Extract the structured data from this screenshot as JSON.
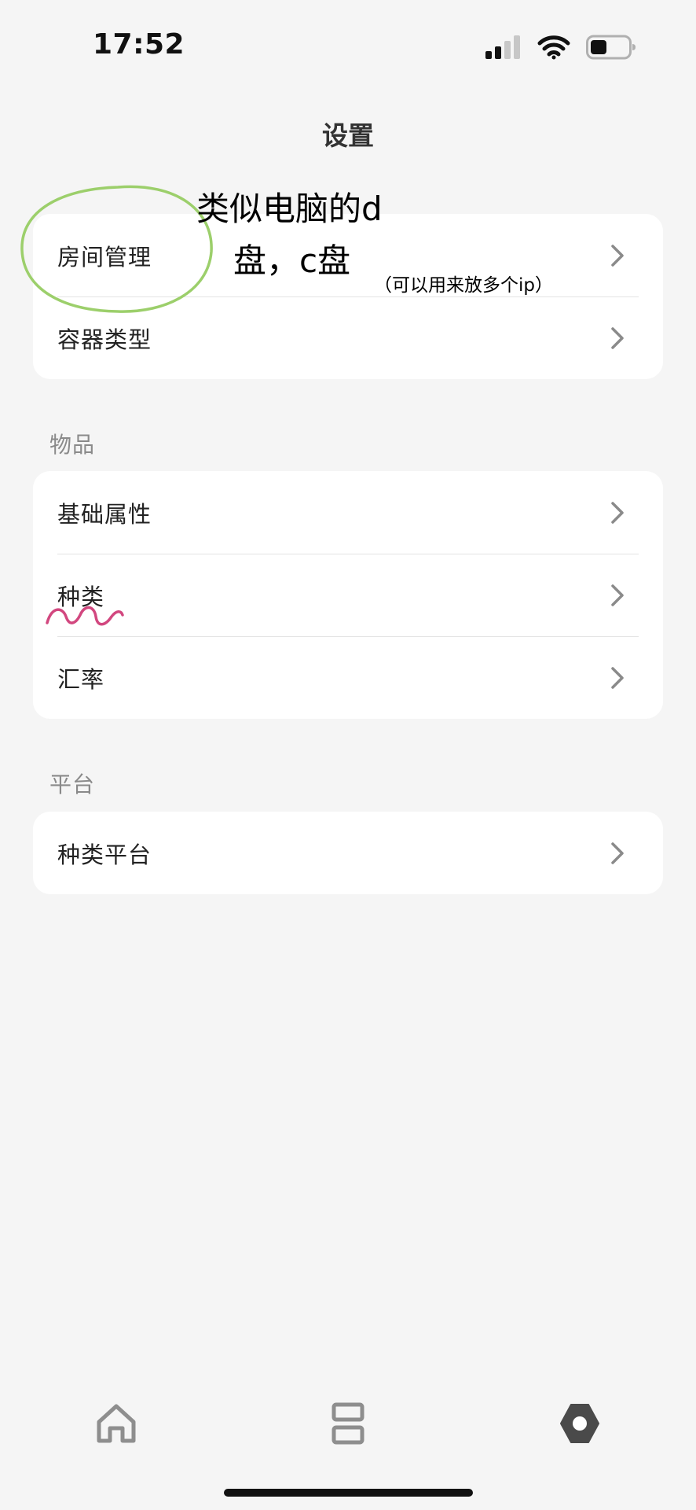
{
  "status_bar": {
    "time": "17:52",
    "icons": [
      "signal-icon",
      "wifi-icon",
      "battery-icon"
    ]
  },
  "header": {
    "title": "设置"
  },
  "groups": [
    {
      "title": "",
      "items": [
        {
          "label": "房间管理"
        },
        {
          "label": "容器类型"
        }
      ]
    },
    {
      "title": "物品",
      "items": [
        {
          "label": "基础属性"
        },
        {
          "label": "种类"
        },
        {
          "label": "汇率"
        }
      ]
    },
    {
      "title": "平台",
      "items": [
        {
          "label": "种类平台"
        }
      ]
    }
  ],
  "annotations": {
    "line1": "类似电脑的d",
    "line2": "盘，c盘",
    "note": "（可以用来放多个ip）",
    "circle_color": "#9ccf6b",
    "squiggle_color": "#d2477f"
  },
  "tab_bar": {
    "items": [
      {
        "icon": "home-icon",
        "active": false
      },
      {
        "icon": "list-icon",
        "active": false
      },
      {
        "icon": "settings-icon",
        "active": true
      }
    ],
    "active_color": "#4a4a4a",
    "inactive_color": "#8e8e8e"
  }
}
